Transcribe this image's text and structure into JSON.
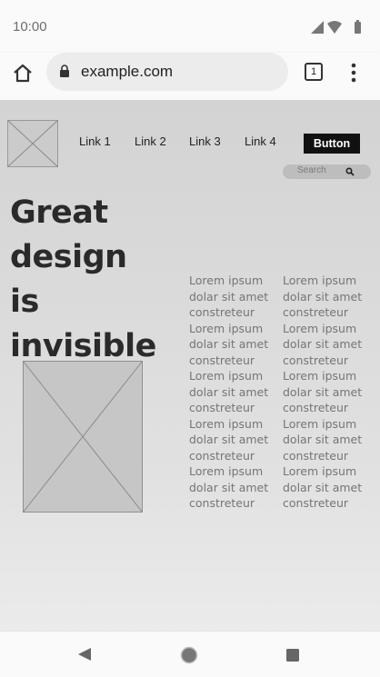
{
  "status_bar": {
    "time": "10:00",
    "icons": [
      "signal-icon",
      "wifi-icon",
      "battery-icon"
    ]
  },
  "browser": {
    "url": "example.com",
    "tab_count": "1",
    "icons": [
      "home-icon",
      "lock-icon",
      "tabs-icon",
      "overflow-menu-icon"
    ]
  },
  "page": {
    "nav_links": [
      "Link 1",
      "Link 2",
      "Link 3",
      "Link 4"
    ],
    "button_label": "Button",
    "search_placeholder": "Search",
    "headline_lines": [
      "Great design",
      "is",
      "invisible"
    ],
    "text_columns": [
      [
        "Lorem ipsum",
        "dolar sit amet",
        "constreteur",
        "Lorem ipsum",
        "dolar sit amet",
        "constreteur",
        "Lorem ipsum",
        "dolar sit amet",
        "constreteur",
        "Lorem ipsum",
        "dolar sit amet",
        "constreteur",
        "Lorem ipsum",
        "dolar sit amet",
        "constreteur"
      ],
      [
        "Lorem ipsum",
        "dolar sit amet",
        "constreteur",
        "Lorem ipsum",
        "dolar sit amet",
        "constreteur",
        "Lorem ipsum",
        "dolar sit amet",
        "constreteur",
        "Lorem ipsum",
        "dolar sit amet",
        "constreteur",
        "Lorem ipsum",
        "dolar sit amet",
        "constreteur"
      ]
    ]
  },
  "nav_bar": {
    "buttons": [
      "back-icon",
      "home-icon",
      "recents-icon"
    ]
  },
  "colors": {
    "button_bg": "#111111",
    "content_bg": "#d6d6d6",
    "headline": "#2a2a2a",
    "body_text": "#757575"
  }
}
